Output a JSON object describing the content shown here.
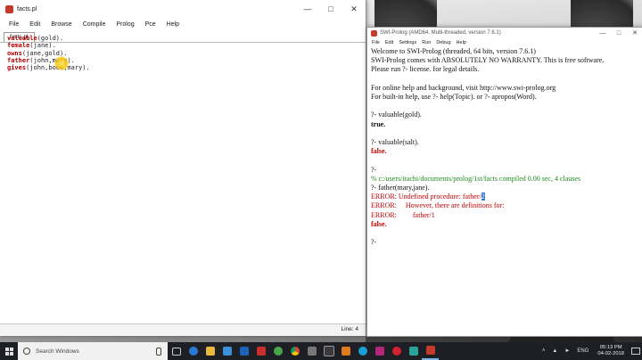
{
  "editor": {
    "title": "facts.pl",
    "menu": [
      "File",
      "Edit",
      "Browse",
      "Compile",
      "Prolog",
      "Pce",
      "Help"
    ],
    "tab": "facts.pl",
    "lines": [
      {
        "kw": "valuable",
        "rest": "(gold)."
      },
      {
        "kw": "female",
        "rest": "(jane)."
      },
      {
        "kw": "owns",
        "rest": "(jane,gold)."
      },
      {
        "kw": "father",
        "rest": "(john,mary)."
      },
      {
        "kw": "gives",
        "rest": "(john,book,mary)."
      }
    ],
    "status": "Line: 4"
  },
  "console": {
    "title": "SWI-Prolog (AMD64, Multi-threaded, version 7.6.1)",
    "menu": [
      "File",
      "Edit",
      "Settings",
      "Run",
      "Debug",
      "Help"
    ],
    "lines": [
      {
        "text": "Welcome to SWI-Prolog (threaded, 64 bits, version 7.6.1)",
        "cls": ""
      },
      {
        "text": "SWI-Prolog comes with ABSOLUTELY NO WARRANTY. This is free software.",
        "cls": ""
      },
      {
        "text": "Please run ?- license. for legal details.",
        "cls": ""
      },
      {
        "text": "",
        "cls": ""
      },
      {
        "text": "For online help and background, visit http://www.swi-prolog.org",
        "cls": ""
      },
      {
        "text": "For built-in help, use ?- help(Topic). or ?- apropos(Word).",
        "cls": ""
      },
      {
        "text": "",
        "cls": ""
      },
      {
        "text": "?- valuable(gold).",
        "cls": ""
      },
      {
        "text": "true.",
        "cls": "true"
      },
      {
        "text": "",
        "cls": ""
      },
      {
        "text": "?- valuable(salt).",
        "cls": ""
      },
      {
        "text": "false.",
        "cls": "false"
      },
      {
        "text": "",
        "cls": ""
      },
      {
        "text": "?-",
        "cls": ""
      },
      {
        "text": "% c:/users/itachi/documents/prolog/1st/facts compiled 0.00 sec, 4 clauses",
        "cls": "green"
      },
      {
        "text": "?- father(mary,jane).",
        "cls": ""
      },
      {
        "text": "ERROR: Undefined procedure: father/2",
        "cls": "err",
        "sel": "2",
        "pre": "ERROR: Undefined procedure: father/"
      },
      {
        "text": "ERROR:     However, there are definitions for:",
        "cls": "err"
      },
      {
        "text": "ERROR:         father/1",
        "cls": "err"
      },
      {
        "text": "false.",
        "cls": "false"
      },
      {
        "text": "",
        "cls": ""
      },
      {
        "text": "?-",
        "cls": ""
      }
    ]
  },
  "taskbar": {
    "search_placeholder": "Search Windows",
    "lang": "ENG",
    "time": "05:13 PM",
    "date": "04-02-2018"
  }
}
